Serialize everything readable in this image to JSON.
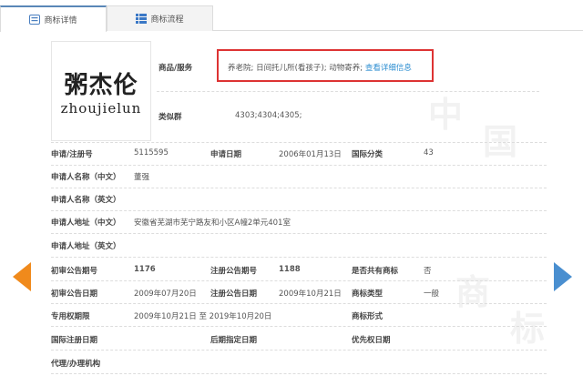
{
  "tabs": [
    {
      "label": "商标详情",
      "icon": "list-doc-icon"
    },
    {
      "label": "商标流程",
      "icon": "list-icon"
    }
  ],
  "logo": {
    "cn": "粥杰伦",
    "en": "zhoujielun"
  },
  "goods": {
    "label": "商品/服务",
    "value": "养老院; 日间托儿所(看孩子); 动物寄养;",
    "link": "查看详细信息"
  },
  "similar": {
    "label": "类似群",
    "value": "4303;4304;4305;"
  },
  "fields": {
    "reg_no": {
      "label": "申请/注册号",
      "value": "5115595"
    },
    "app_date": {
      "label": "申请日期",
      "value": "2006年01月13日"
    },
    "intl_class": {
      "label": "国际分类",
      "value": "43"
    },
    "name_cn": {
      "label": "申请人名称（中文）",
      "value": "董强"
    },
    "name_en": {
      "label": "申请人名称（英文）",
      "value": ""
    },
    "addr_cn": {
      "label": "申请人地址（中文）",
      "value": "安徽省芜湖市芜宁路友和小区A幢2单元401室"
    },
    "addr_en": {
      "label": "申请人地址（英文）",
      "value": ""
    },
    "prelim_no": {
      "label": "初审公告期号",
      "value": "1176"
    },
    "reg_pub_no": {
      "label": "注册公告期号",
      "value": "1188"
    },
    "shared": {
      "label": "是否共有商标",
      "value": "否"
    },
    "prelim_date": {
      "label": "初审公告日期",
      "value": "2009年07月20日"
    },
    "reg_pub_date": {
      "label": "注册公告日期",
      "value": "2009年10月21日"
    },
    "tm_type": {
      "label": "商标类型",
      "value": "一般"
    },
    "term": {
      "label": "专用权期限",
      "value": "2009年10月21日 至 2019年10月20日"
    },
    "tm_form": {
      "label": "商标形式",
      "value": ""
    },
    "intl_reg_date": {
      "label": "国际注册日期",
      "value": ""
    },
    "later_date": {
      "label": "后期指定日期",
      "value": ""
    },
    "priority_date": {
      "label": "优先权日期",
      "value": ""
    },
    "agent": {
      "label": "代理/办理机构",
      "value": ""
    }
  },
  "colors": {
    "prev": "#f08a1c",
    "next": "#4a8fd0",
    "highlight": "#d33333",
    "link": "#2d8ed1"
  }
}
